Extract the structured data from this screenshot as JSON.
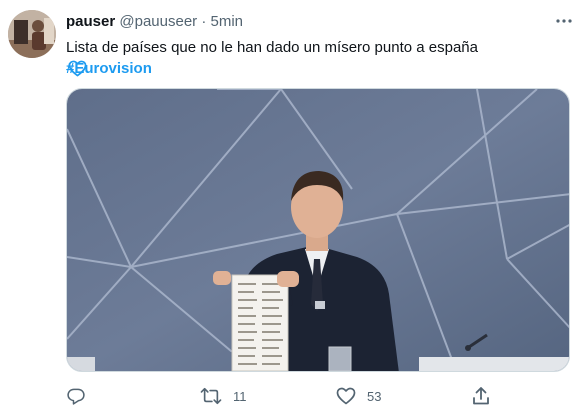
{
  "author": {
    "display_name": "pauser",
    "handle": "@pauuseer",
    "separator": "·",
    "time": "5min"
  },
  "tweet": {
    "text": "Lista de países que no le han dado un mísero punto a españa ",
    "hashtag": "#Eurovision",
    "emoji_icon": "blue-heart-outline-icon"
  },
  "actions": {
    "reply_icon": "reply-icon",
    "retweet_icon": "retweet-icon",
    "retweet_count": "11",
    "like_icon": "heart-icon",
    "like_count": "53",
    "share_icon": "share-icon"
  },
  "colors": {
    "accent": "#1d9bf0",
    "muted": "#536471",
    "text": "#0f1419"
  }
}
